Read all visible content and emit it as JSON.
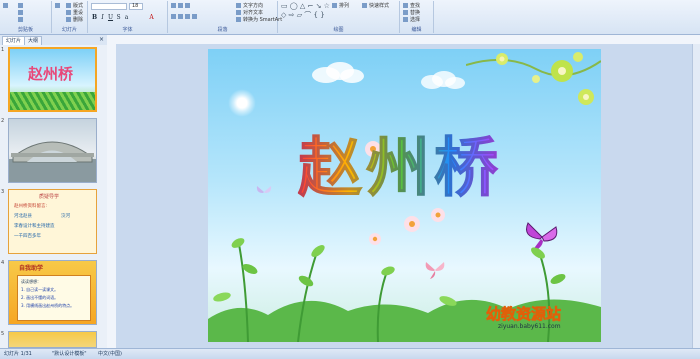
{
  "ribbon": {
    "groups": [
      {
        "name": "clipboard",
        "caption": "剪贴板"
      },
      {
        "name": "slides",
        "caption": "幻灯片"
      },
      {
        "name": "font",
        "caption": "字体"
      },
      {
        "name": "paragraph",
        "caption": "段落"
      },
      {
        "name": "drawing",
        "caption": "绘图"
      },
      {
        "name": "editing",
        "caption": "编辑"
      }
    ],
    "font_size": "18",
    "buttons": {
      "layout": "版式",
      "reset": "重设",
      "delete": "删除",
      "text_direction": "文字方向",
      "align_text": "对齐文本",
      "smartart": "转换为 SmartArt",
      "arrange": "排列",
      "quick_styles": "快速样式",
      "find": "查找",
      "replace": "替换",
      "select": "选择"
    }
  },
  "side_tabs": {
    "tab1": "幻灯片",
    "tab2": "大纲"
  },
  "thumbnails": [
    {
      "num": "1",
      "title": "赵州桥"
    },
    {
      "num": "2",
      "title": ""
    },
    {
      "num": "3",
      "title": "质疑导学",
      "lines": [
        "赵州桥资料留言:",
        "河北赵县",
        "洨河",
        "李春设计和主持建造",
        "一千四百多年"
      ]
    },
    {
      "num": "4",
      "title": "自我助学",
      "lines": [
        "读读想想：",
        "1. 自己读一读课文。",
        "2. 画出不懂的词语。",
        "3. 用横线画出赵州桥的特点。"
      ]
    },
    {
      "num": "5",
      "title": ""
    }
  ],
  "slide": {
    "title": "赵州桥",
    "logo_text": "幼教资源站",
    "logo_url": "ziyuan.baby611.com"
  },
  "status": {
    "slide_num": "幻灯片 1/31",
    "theme": "\"默认设计模板\"",
    "lang": "中文(中国)"
  },
  "colors": {
    "accent": "#f5a623",
    "ribbon": "#d7e4f4",
    "sky": "#7ed0f6"
  }
}
